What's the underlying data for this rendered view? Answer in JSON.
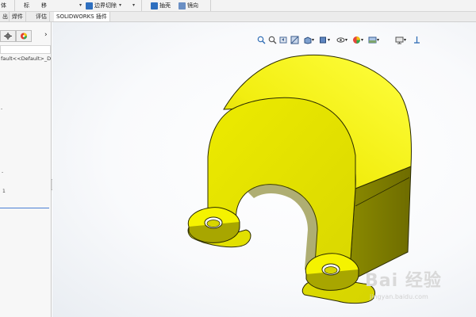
{
  "ribbon": {
    "item_left": "体",
    "item_mid1": "标",
    "item_mid2": "移",
    "boundary_cut": "边界切除",
    "shell": "抽壳",
    "mirror": "镜向"
  },
  "tabs": [
    {
      "label": "出"
    },
    {
      "label": "焊件"
    },
    {
      "label": "评估"
    },
    {
      "label": "SOLIDWORKS 插件"
    }
  ],
  "panel": {
    "config_text": "fault<<Default>_Disp",
    "expand_arrow": "›",
    "mark_a": "-",
    "mark_b": "1"
  },
  "viewport": {
    "model_color": "#f0f000",
    "model_edge_color": "#202000"
  },
  "watermark": {
    "text": "Bai 经验",
    "url": "jingyan.baidu.com"
  }
}
